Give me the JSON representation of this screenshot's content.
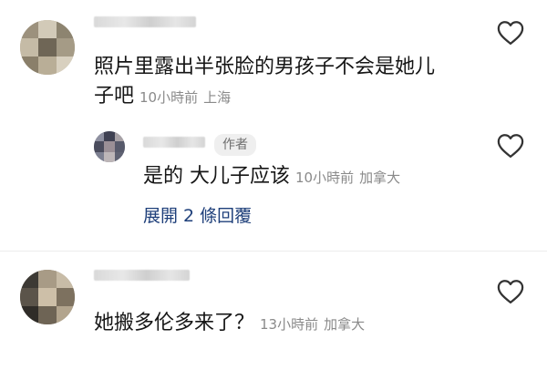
{
  "comments": [
    {
      "text_line1": "照片里露出半张脸的男孩子不会是她儿",
      "text_line2": "子吧",
      "time": "10小時前",
      "location": "上海"
    },
    {
      "badge": "作者",
      "text": "是的 大儿子应该",
      "time": "10小時前",
      "location": "加拿大",
      "expand_label": "展開 2 條回覆"
    },
    {
      "text": "她搬多伦多来了？",
      "time": "13小時前",
      "location": "加拿大"
    }
  ],
  "icons": {
    "like": "heart-outline-icon"
  }
}
